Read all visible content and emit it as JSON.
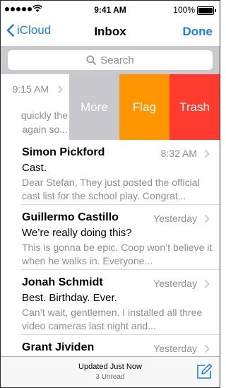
{
  "status_bar": {
    "time": "9:41 AM",
    "battery": "100%"
  },
  "nav": {
    "back_label": "iCloud",
    "title": "Inbox",
    "done_label": "Done"
  },
  "search": {
    "placeholder": "Search"
  },
  "swiped_row": {
    "time": "9:15 AM",
    "preview_lines": [
      "quickly the",
      "again so..."
    ],
    "actions": {
      "more": "More",
      "flag": "Flag",
      "trash": "Trash"
    }
  },
  "messages": [
    {
      "sender": "Simon Pickford",
      "time": "8:32 AM",
      "subject": "Cast.",
      "preview": "Dear Stefan, They just posted the official cast list for the school play. Congrat..."
    },
    {
      "sender": "Guillermo Castillo",
      "time": "Yesterday",
      "subject": "We’re really doing this?",
      "preview": "This is gonna be epic. Coop won’t believe it when he walks in. Everyone..."
    },
    {
      "sender": "Jonah Schmidt",
      "time": "Yesterday",
      "subject": "Best. Birthday. Ever.",
      "preview": "Can’t wait, gentlemen. I installed all three video cameras last night and..."
    },
    {
      "sender": "Grant Jividen",
      "time": "Yesterday",
      "subject": "",
      "preview": ""
    }
  ],
  "toolbar": {
    "status": "Updated Just Now",
    "unread": "3 Unread"
  },
  "colors": {
    "accent": "#1a7cf5",
    "more": "#c7c7cc",
    "flag": "#ff9500",
    "trash": "#ff3b30"
  },
  "icons": [
    "wifi-icon",
    "battery-icon",
    "back-chevron-icon",
    "search-icon",
    "chevron-right-icon",
    "compose-icon"
  ]
}
